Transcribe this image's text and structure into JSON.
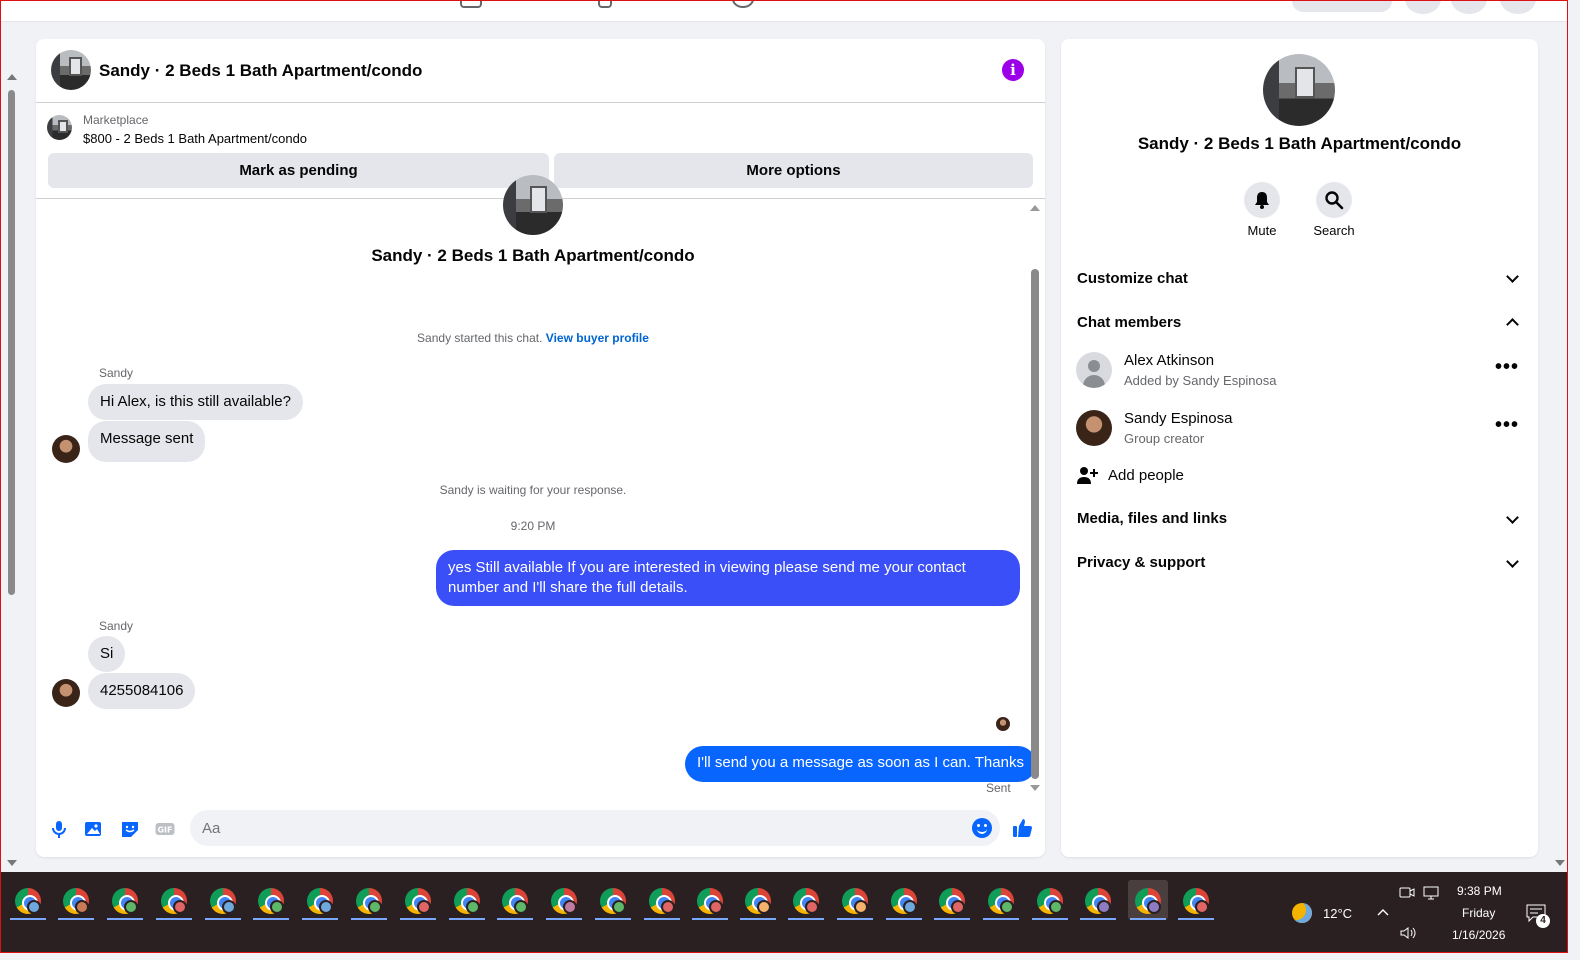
{
  "chat": {
    "header_title": "Sandy · 2 Beds 1 Bath Apartment/condo",
    "marketplace_label": "Marketplace",
    "marketplace_item": "$800 - 2 Beds 1 Bath Apartment/condo",
    "mark_pending": "Mark as pending",
    "more_options": "More options",
    "center_title": "Sandy · 2 Beds 1 Bath Apartment/condo",
    "started_text": "Sandy started this chat.",
    "view_buyer_profile": "View buyer profile",
    "sender_name": "Sandy",
    "msg1": "Hi Alex, is this still available?",
    "msg2": "Message sent",
    "waiting_text": "Sandy is waiting for your response.",
    "time": "9:20 PM",
    "out1": "yes Still available If you are interested in viewing please send me your contact number and I'll share the full details.",
    "msg3": "Si",
    "msg4": "4255084106",
    "out2": "I'll send you a message as soon as I can. Thanks",
    "sent_label": "Sent",
    "input_placeholder": "Aa"
  },
  "details": {
    "title": "Sandy · 2 Beds 1 Bath Apartment/condo",
    "mute": "Mute",
    "search": "Search",
    "customize_chat": "Customize chat",
    "chat_members": "Chat members",
    "members": [
      {
        "name": "Alex Atkinson",
        "sub": "Added by Sandy Espinosa"
      },
      {
        "name": "Sandy Espinosa",
        "sub": "Group creator"
      }
    ],
    "add_people": "Add people",
    "media": "Media, files and links",
    "privacy": "Privacy & support"
  },
  "taskbar": {
    "temperature": "12°C",
    "time": "9:38 PM",
    "day": "Friday",
    "date": "1/16/2026",
    "notifications": "4",
    "app_badges": [
      "#6fa8dc",
      "#c97b55",
      "#5fb86a",
      "#e06666",
      "#6fa8dc",
      "#5fb86a",
      "#6fa8dc",
      "#5fb86a",
      "#e06666",
      "#5fb86a",
      "#5fb86a",
      "#c27ba0",
      "#5fb86a",
      "#e06666",
      "#e06666",
      "#f6b26b",
      "#e06666",
      "#f6b26b",
      "#6fa8dc",
      "#e06666",
      "#5fb86a",
      "#5fb86a",
      "#8e7cc3",
      "#8e7cc3",
      "#e06666"
    ]
  },
  "colors": {
    "accent": "#3a4ff7",
    "link": "#0064d1",
    "info": "#9b00e8"
  }
}
